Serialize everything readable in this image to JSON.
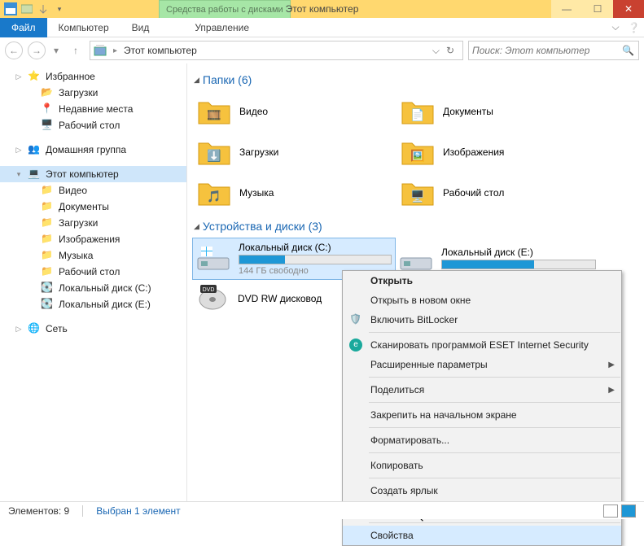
{
  "titlebar": {
    "tools": "Средства работы с дисками",
    "title": "Этот компьютер"
  },
  "menubar": {
    "file": "Файл",
    "computer": "Компьютер",
    "view": "Вид",
    "manage": "Управление"
  },
  "address": {
    "location": "Этот компьютер"
  },
  "search": {
    "placeholder": "Поиск: Этот компьютер"
  },
  "sidebar": {
    "fav": "Избранное",
    "fav_items": [
      "Загрузки",
      "Недавние места",
      "Рабочий стол"
    ],
    "homegroup": "Домашняя группа",
    "thispc": "Этот компьютер",
    "pc_items": [
      "Видео",
      "Документы",
      "Загрузки",
      "Изображения",
      "Музыка",
      "Рабочий стол",
      "Локальный диск (C:)",
      "Локальный диск (E:)"
    ],
    "network": "Сеть"
  },
  "main": {
    "folders_hdr": "Папки (6)",
    "folders": [
      "Видео",
      "Документы",
      "Загрузки",
      "Изображения",
      "Музыка",
      "Рабочий стол"
    ],
    "drives_hdr": "Устройства и диски (3)",
    "drives": [
      {
        "name": "Локальный диск (C:)",
        "sub": "144 ГБ свободно",
        "pct": 30,
        "sel": true
      },
      {
        "name": "Локальный диск (E:)",
        "sub": "",
        "pct": 60,
        "sel": false
      },
      {
        "name": "DVD RW дисковод",
        "sub": "",
        "pct": -1,
        "sel": false
      }
    ]
  },
  "ctx": {
    "open": "Открыть",
    "newwin": "Открыть в новом окне",
    "bitlocker": "Включить BitLocker",
    "eset": "Сканировать программой ESET Internet Security",
    "advanced": "Расширенные параметры",
    "share": "Поделиться",
    "pin": "Закрепить на начальном экране",
    "format": "Форматировать...",
    "copy": "Копировать",
    "shortcut": "Создать ярлык",
    "rename": "Переименовать",
    "props": "Свойства"
  },
  "status": {
    "count": "Элементов: 9",
    "selection": "Выбран 1 элемент"
  }
}
